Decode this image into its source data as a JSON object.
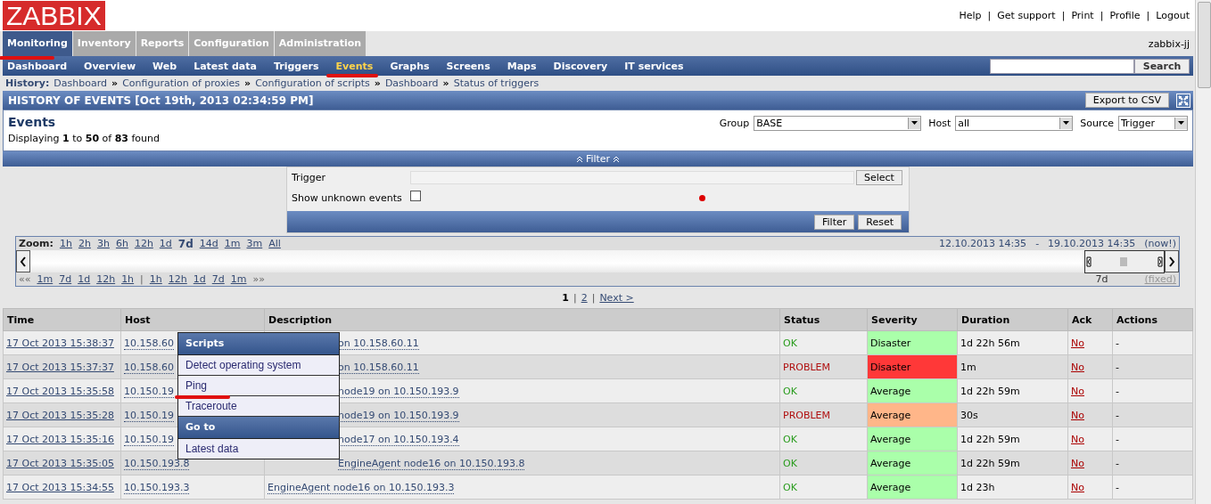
{
  "logo": "ZABBIX",
  "top_links": [
    "Help",
    "Get support",
    "Print",
    "Profile",
    "Logout"
  ],
  "top_links_separator": "|",
  "main_menu": [
    {
      "label": "Monitoring",
      "selected": true,
      "marked": true
    },
    {
      "label": "Inventory",
      "selected": false,
      "marked": false
    },
    {
      "label": "Reports",
      "selected": false,
      "marked": false
    },
    {
      "label": "Configuration",
      "selected": false,
      "marked": false
    },
    {
      "label": "Administration",
      "selected": false,
      "marked": false
    }
  ],
  "user": "zabbix-jj",
  "sub_menu": [
    {
      "label": "Dashboard",
      "selected": false,
      "marked": false
    },
    {
      "label": "Overview",
      "selected": false,
      "marked": false
    },
    {
      "label": "Web",
      "selected": false,
      "marked": false
    },
    {
      "label": "Latest data",
      "selected": false,
      "marked": false
    },
    {
      "label": "Triggers",
      "selected": false,
      "marked": false
    },
    {
      "label": "Events",
      "selected": true,
      "marked": true
    },
    {
      "label": "Graphs",
      "selected": false,
      "marked": false
    },
    {
      "label": "Screens",
      "selected": false,
      "marked": false
    },
    {
      "label": "Maps",
      "selected": false,
      "marked": false
    },
    {
      "label": "Discovery",
      "selected": false,
      "marked": false
    },
    {
      "label": "IT services",
      "selected": false,
      "marked": false
    }
  ],
  "search": {
    "button": "Search"
  },
  "history": {
    "label": "History:",
    "separator": "»",
    "items": [
      "Dashboard",
      "Configuration of proxies",
      "Configuration of scripts",
      "Dashboard",
      "Status of triggers"
    ]
  },
  "page_title": "HISTORY OF EVENTS [Oct 19th, 2013 02:34:59 PM]",
  "export_button": "Export to CSV",
  "panel": {
    "title": "Events",
    "displaying": "Displaying **1** to **50** of **83** found",
    "selects": [
      {
        "label": "Group",
        "value": "BASE"
      },
      {
        "label": "Host",
        "value": "all"
      },
      {
        "label": "Source",
        "value": "Trigger"
      }
    ]
  },
  "filter": {
    "title": "Filter",
    "trigger_label": "Trigger",
    "select_button": "Select",
    "unknown_label": "Show unknown events",
    "unknown_checked": false,
    "buttons": [
      "Filter",
      "Reset"
    ]
  },
  "zoom": {
    "label": "Zoom:",
    "periods": [
      {
        "label": "1h",
        "selected": false
      },
      {
        "label": "2h",
        "selected": false
      },
      {
        "label": "3h",
        "selected": false
      },
      {
        "label": "6h",
        "selected": false
      },
      {
        "label": "12h",
        "selected": false
      },
      {
        "label": "1d",
        "selected": false
      },
      {
        "label": "7d",
        "selected": true
      },
      {
        "label": "14d",
        "selected": false
      },
      {
        "label": "1m",
        "selected": false
      },
      {
        "label": "3m",
        "selected": false
      },
      {
        "label": "All",
        "selected": false
      }
    ],
    "range_from": "12.10.2013 14:35",
    "range_sep": "-",
    "range_to": "19.10.2013 14:35",
    "now": "(now!)",
    "back_label": "««",
    "back": [
      "1m",
      "7d",
      "1d",
      "12h",
      "1h"
    ],
    "separator": "|",
    "forward": [
      "1h",
      "12h",
      "1d",
      "7d",
      "1m"
    ],
    "forward_label": "»»",
    "period": "7d",
    "fixed": "(fixed)"
  },
  "pager_separator": "|",
  "pager": [
    {
      "label": "1",
      "selected": true
    },
    {
      "label": "2",
      "selected": false
    },
    {
      "label": "Next >",
      "selected": false
    }
  ],
  "table": {
    "columns": [
      "Time",
      "Host",
      "Description",
      "Status",
      "Severity",
      "Duration",
      "Ack",
      "Actions"
    ],
    "rows": [
      {
        "time": "17 Oct 2013 15:38:37",
        "host": "10.158.60",
        "description": "on 10.158.60.11",
        "status": "OK",
        "problem": false,
        "severity": "Disaster",
        "color": "#aaffaa",
        "duration": "1d 22h 56m",
        "ack": "No",
        "actions": "-"
      },
      {
        "time": "17 Oct 2013 15:37:37",
        "host": "10.158.60",
        "description": "on 10.158.60.11",
        "status": "PROBLEM",
        "problem": true,
        "severity": "Disaster",
        "color": "#ff3838",
        "duration": "1m",
        "ack": "No",
        "actions": "-"
      },
      {
        "time": "17 Oct 2013 15:35:58",
        "host": "10.150.19",
        "description": "node19 on 10.150.193.9",
        "status": "OK",
        "problem": false,
        "severity": "Average",
        "color": "#aaffaa",
        "duration": "1d 22h 59m",
        "ack": "No",
        "actions": "-"
      },
      {
        "time": "17 Oct 2013 15:35:28",
        "host": "10.150.19",
        "description": "node19 on 10.150.193.9",
        "status": "PROBLEM",
        "problem": true,
        "severity": "Average",
        "color": "#ffb689",
        "duration": "30s",
        "ack": "No",
        "actions": "-"
      },
      {
        "time": "17 Oct 2013 15:35:16",
        "host": "10.150.19",
        "description": "node17 on 10.150.193.4",
        "status": "OK",
        "problem": false,
        "severity": "Average",
        "color": "#aaffaa",
        "duration": "1d 22h 59m",
        "ack": "No",
        "actions": "-"
      },
      {
        "time": "17 Oct 2013 15:35:05",
        "host": "10.150.193.8",
        "description": "EngineAgent node16 on 10.150.193.8",
        "status": "OK",
        "problem": false,
        "severity": "Average",
        "color": "#aaffaa",
        "duration": "1d 22h 59m",
        "ack": "No",
        "actions": "-"
      },
      {
        "time": "17 Oct 2013 15:34:55",
        "host": "10.150.193.3",
        "description": "EngineAgent node16 on 10.150.193.3",
        "status": "OK",
        "problem": false,
        "severity": "Average",
        "color": "#aaffaa",
        "duration": "1d 23h",
        "ack": "No",
        "actions": "-"
      }
    ]
  },
  "context_menu": {
    "sections": [
      {
        "title": "Scripts",
        "items": [
          {
            "label": "Detect operating system",
            "marked": false
          },
          {
            "label": "Ping",
            "marked": true
          },
          {
            "label": "Traceroute",
            "marked": false
          }
        ]
      },
      {
        "title": "Go to",
        "items": [
          {
            "label": "Latest data",
            "marked": false
          }
        ]
      }
    ]
  }
}
